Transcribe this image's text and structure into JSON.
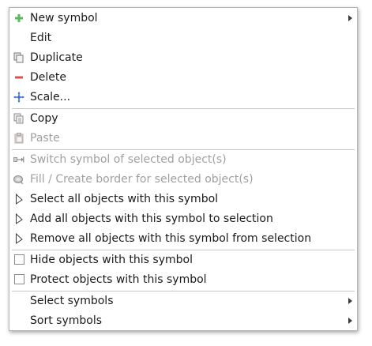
{
  "menu": {
    "items": [
      {
        "label": "New symbol",
        "icon": "plus-icon",
        "submenu": true,
        "enabled": true
      },
      {
        "label": "Edit",
        "icon": null,
        "enabled": true
      },
      {
        "label": "Duplicate",
        "icon": "duplicate-icon",
        "enabled": true
      },
      {
        "label": "Delete",
        "icon": "minus-icon",
        "enabled": true
      },
      {
        "label": "Scale...",
        "icon": "scale-icon",
        "enabled": true
      },
      {
        "label": "Copy",
        "icon": "copy-icon",
        "enabled": true
      },
      {
        "label": "Paste",
        "icon": "paste-icon",
        "enabled": false
      },
      {
        "label": "Switch symbol of selected object(s)",
        "icon": "switch-symbol-icon",
        "enabled": false
      },
      {
        "label": "Fill / Create border for selected object(s)",
        "icon": "fill-border-icon",
        "enabled": false
      },
      {
        "label": "Select all objects with this symbol",
        "icon": "select-cursor-icon",
        "enabled": true
      },
      {
        "label": "Add all objects with this symbol to selection",
        "icon": "select-cursor-icon",
        "enabled": true
      },
      {
        "label": "Remove all objects with this symbol from selection",
        "icon": "select-cursor-icon",
        "enabled": true
      },
      {
        "label": "Hide objects with this symbol",
        "checkbox": true,
        "checked": false,
        "enabled": true
      },
      {
        "label": "Protect objects with this symbol",
        "checkbox": true,
        "checked": false,
        "enabled": true
      },
      {
        "label": "Select symbols",
        "submenu": true,
        "enabled": true
      },
      {
        "label": "Sort symbols",
        "submenu": true,
        "enabled": true
      }
    ]
  },
  "colors": {
    "plus": "#5cb85c",
    "minus": "#d9534f",
    "scale": "#3a6fc4",
    "disabled_text": "#a0a0a0"
  }
}
